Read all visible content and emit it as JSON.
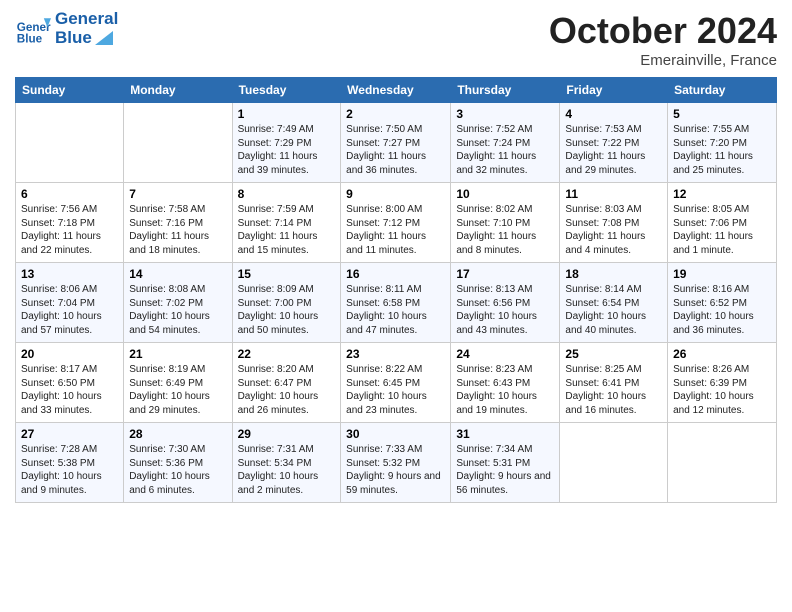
{
  "header": {
    "logo_text_general": "General",
    "logo_text_blue": "Blue",
    "month_title": "October 2024",
    "location": "Emerainville, France"
  },
  "days_of_week": [
    "Sunday",
    "Monday",
    "Tuesday",
    "Wednesday",
    "Thursday",
    "Friday",
    "Saturday"
  ],
  "weeks": [
    [
      {
        "day": "",
        "sunrise": "",
        "sunset": "",
        "daylight": ""
      },
      {
        "day": "",
        "sunrise": "",
        "sunset": "",
        "daylight": ""
      },
      {
        "day": "1",
        "sunrise": "Sunrise: 7:49 AM",
        "sunset": "Sunset: 7:29 PM",
        "daylight": "Daylight: 11 hours and 39 minutes."
      },
      {
        "day": "2",
        "sunrise": "Sunrise: 7:50 AM",
        "sunset": "Sunset: 7:27 PM",
        "daylight": "Daylight: 11 hours and 36 minutes."
      },
      {
        "day": "3",
        "sunrise": "Sunrise: 7:52 AM",
        "sunset": "Sunset: 7:24 PM",
        "daylight": "Daylight: 11 hours and 32 minutes."
      },
      {
        "day": "4",
        "sunrise": "Sunrise: 7:53 AM",
        "sunset": "Sunset: 7:22 PM",
        "daylight": "Daylight: 11 hours and 29 minutes."
      },
      {
        "day": "5",
        "sunrise": "Sunrise: 7:55 AM",
        "sunset": "Sunset: 7:20 PM",
        "daylight": "Daylight: 11 hours and 25 minutes."
      }
    ],
    [
      {
        "day": "6",
        "sunrise": "Sunrise: 7:56 AM",
        "sunset": "Sunset: 7:18 PM",
        "daylight": "Daylight: 11 hours and 22 minutes."
      },
      {
        "day": "7",
        "sunrise": "Sunrise: 7:58 AM",
        "sunset": "Sunset: 7:16 PM",
        "daylight": "Daylight: 11 hours and 18 minutes."
      },
      {
        "day": "8",
        "sunrise": "Sunrise: 7:59 AM",
        "sunset": "Sunset: 7:14 PM",
        "daylight": "Daylight: 11 hours and 15 minutes."
      },
      {
        "day": "9",
        "sunrise": "Sunrise: 8:00 AM",
        "sunset": "Sunset: 7:12 PM",
        "daylight": "Daylight: 11 hours and 11 minutes."
      },
      {
        "day": "10",
        "sunrise": "Sunrise: 8:02 AM",
        "sunset": "Sunset: 7:10 PM",
        "daylight": "Daylight: 11 hours and 8 minutes."
      },
      {
        "day": "11",
        "sunrise": "Sunrise: 8:03 AM",
        "sunset": "Sunset: 7:08 PM",
        "daylight": "Daylight: 11 hours and 4 minutes."
      },
      {
        "day": "12",
        "sunrise": "Sunrise: 8:05 AM",
        "sunset": "Sunset: 7:06 PM",
        "daylight": "Daylight: 11 hours and 1 minute."
      }
    ],
    [
      {
        "day": "13",
        "sunrise": "Sunrise: 8:06 AM",
        "sunset": "Sunset: 7:04 PM",
        "daylight": "Daylight: 10 hours and 57 minutes."
      },
      {
        "day": "14",
        "sunrise": "Sunrise: 8:08 AM",
        "sunset": "Sunset: 7:02 PM",
        "daylight": "Daylight: 10 hours and 54 minutes."
      },
      {
        "day": "15",
        "sunrise": "Sunrise: 8:09 AM",
        "sunset": "Sunset: 7:00 PM",
        "daylight": "Daylight: 10 hours and 50 minutes."
      },
      {
        "day": "16",
        "sunrise": "Sunrise: 8:11 AM",
        "sunset": "Sunset: 6:58 PM",
        "daylight": "Daylight: 10 hours and 47 minutes."
      },
      {
        "day": "17",
        "sunrise": "Sunrise: 8:13 AM",
        "sunset": "Sunset: 6:56 PM",
        "daylight": "Daylight: 10 hours and 43 minutes."
      },
      {
        "day": "18",
        "sunrise": "Sunrise: 8:14 AM",
        "sunset": "Sunset: 6:54 PM",
        "daylight": "Daylight: 10 hours and 40 minutes."
      },
      {
        "day": "19",
        "sunrise": "Sunrise: 8:16 AM",
        "sunset": "Sunset: 6:52 PM",
        "daylight": "Daylight: 10 hours and 36 minutes."
      }
    ],
    [
      {
        "day": "20",
        "sunrise": "Sunrise: 8:17 AM",
        "sunset": "Sunset: 6:50 PM",
        "daylight": "Daylight: 10 hours and 33 minutes."
      },
      {
        "day": "21",
        "sunrise": "Sunrise: 8:19 AM",
        "sunset": "Sunset: 6:49 PM",
        "daylight": "Daylight: 10 hours and 29 minutes."
      },
      {
        "day": "22",
        "sunrise": "Sunrise: 8:20 AM",
        "sunset": "Sunset: 6:47 PM",
        "daylight": "Daylight: 10 hours and 26 minutes."
      },
      {
        "day": "23",
        "sunrise": "Sunrise: 8:22 AM",
        "sunset": "Sunset: 6:45 PM",
        "daylight": "Daylight: 10 hours and 23 minutes."
      },
      {
        "day": "24",
        "sunrise": "Sunrise: 8:23 AM",
        "sunset": "Sunset: 6:43 PM",
        "daylight": "Daylight: 10 hours and 19 minutes."
      },
      {
        "day": "25",
        "sunrise": "Sunrise: 8:25 AM",
        "sunset": "Sunset: 6:41 PM",
        "daylight": "Daylight: 10 hours and 16 minutes."
      },
      {
        "day": "26",
        "sunrise": "Sunrise: 8:26 AM",
        "sunset": "Sunset: 6:39 PM",
        "daylight": "Daylight: 10 hours and 12 minutes."
      }
    ],
    [
      {
        "day": "27",
        "sunrise": "Sunrise: 7:28 AM",
        "sunset": "Sunset: 5:38 PM",
        "daylight": "Daylight: 10 hours and 9 minutes."
      },
      {
        "day": "28",
        "sunrise": "Sunrise: 7:30 AM",
        "sunset": "Sunset: 5:36 PM",
        "daylight": "Daylight: 10 hours and 6 minutes."
      },
      {
        "day": "29",
        "sunrise": "Sunrise: 7:31 AM",
        "sunset": "Sunset: 5:34 PM",
        "daylight": "Daylight: 10 hours and 2 minutes."
      },
      {
        "day": "30",
        "sunrise": "Sunrise: 7:33 AM",
        "sunset": "Sunset: 5:32 PM",
        "daylight": "Daylight: 9 hours and 59 minutes."
      },
      {
        "day": "31",
        "sunrise": "Sunrise: 7:34 AM",
        "sunset": "Sunset: 5:31 PM",
        "daylight": "Daylight: 9 hours and 56 minutes."
      },
      {
        "day": "",
        "sunrise": "",
        "sunset": "",
        "daylight": ""
      },
      {
        "day": "",
        "sunrise": "",
        "sunset": "",
        "daylight": ""
      }
    ]
  ]
}
